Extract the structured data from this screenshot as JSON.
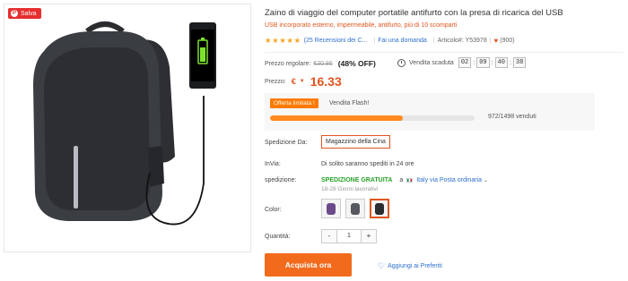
{
  "image_panel": {
    "save_label": "Salva"
  },
  "product": {
    "title": "Zaino di viaggio del computer portatile antifurto con la presa di ricarica del USB",
    "subtitle": "USB incorporato esterno, impermeabile, antifurto, più di 10 scomparti",
    "stars": "★★★★★",
    "reviews_link": "(25 Recensioni dei C...",
    "question_link": "Fai una domanda",
    "sku": "Articolo#: Y53978",
    "favorites": "(900)"
  },
  "price": {
    "regular_label": "Prezzo regolare:",
    "regular_value": "€30.86",
    "discount": "(48% OFF)",
    "countdown_label": "Vendita scaduta",
    "countdown": [
      "02",
      "09",
      "40",
      "38"
    ],
    "price_label": "Prezzo:",
    "currency": "€",
    "currency_caret": "▼",
    "value": "16.33"
  },
  "flash": {
    "tag": "Offerta limitata !",
    "label": "Vendita Flash!",
    "sold_fraction": 0.649,
    "sold_text": "972/1498 venduti"
  },
  "shipping": {
    "from_label": "Spedizione Da:",
    "warehouse": "Magazzino della Cina",
    "invia_label": "InVia:",
    "invia_text": "Di solito saranno spediti in 24 ore",
    "ship_label": "spedizione:",
    "free": "SPEDIZIONE GRATUITA",
    "to_prefix": "a",
    "destination": "Italy via Posta ordinaria",
    "days": "18-28 Giorni lavorativi"
  },
  "options": {
    "color_label": "Color:",
    "swatches": [
      "purple",
      "grey",
      "black"
    ],
    "qty_label": "Quantità:",
    "qty_minus": "-",
    "qty_value": "1",
    "qty_plus": "+"
  },
  "actions": {
    "buy": "Acquista ora",
    "wishlist": "Aggiungi ai Preferiti"
  },
  "colors": {
    "accent": "#f26b1d",
    "link": "#2e6fcc",
    "free_ship": "#2aa12a"
  }
}
